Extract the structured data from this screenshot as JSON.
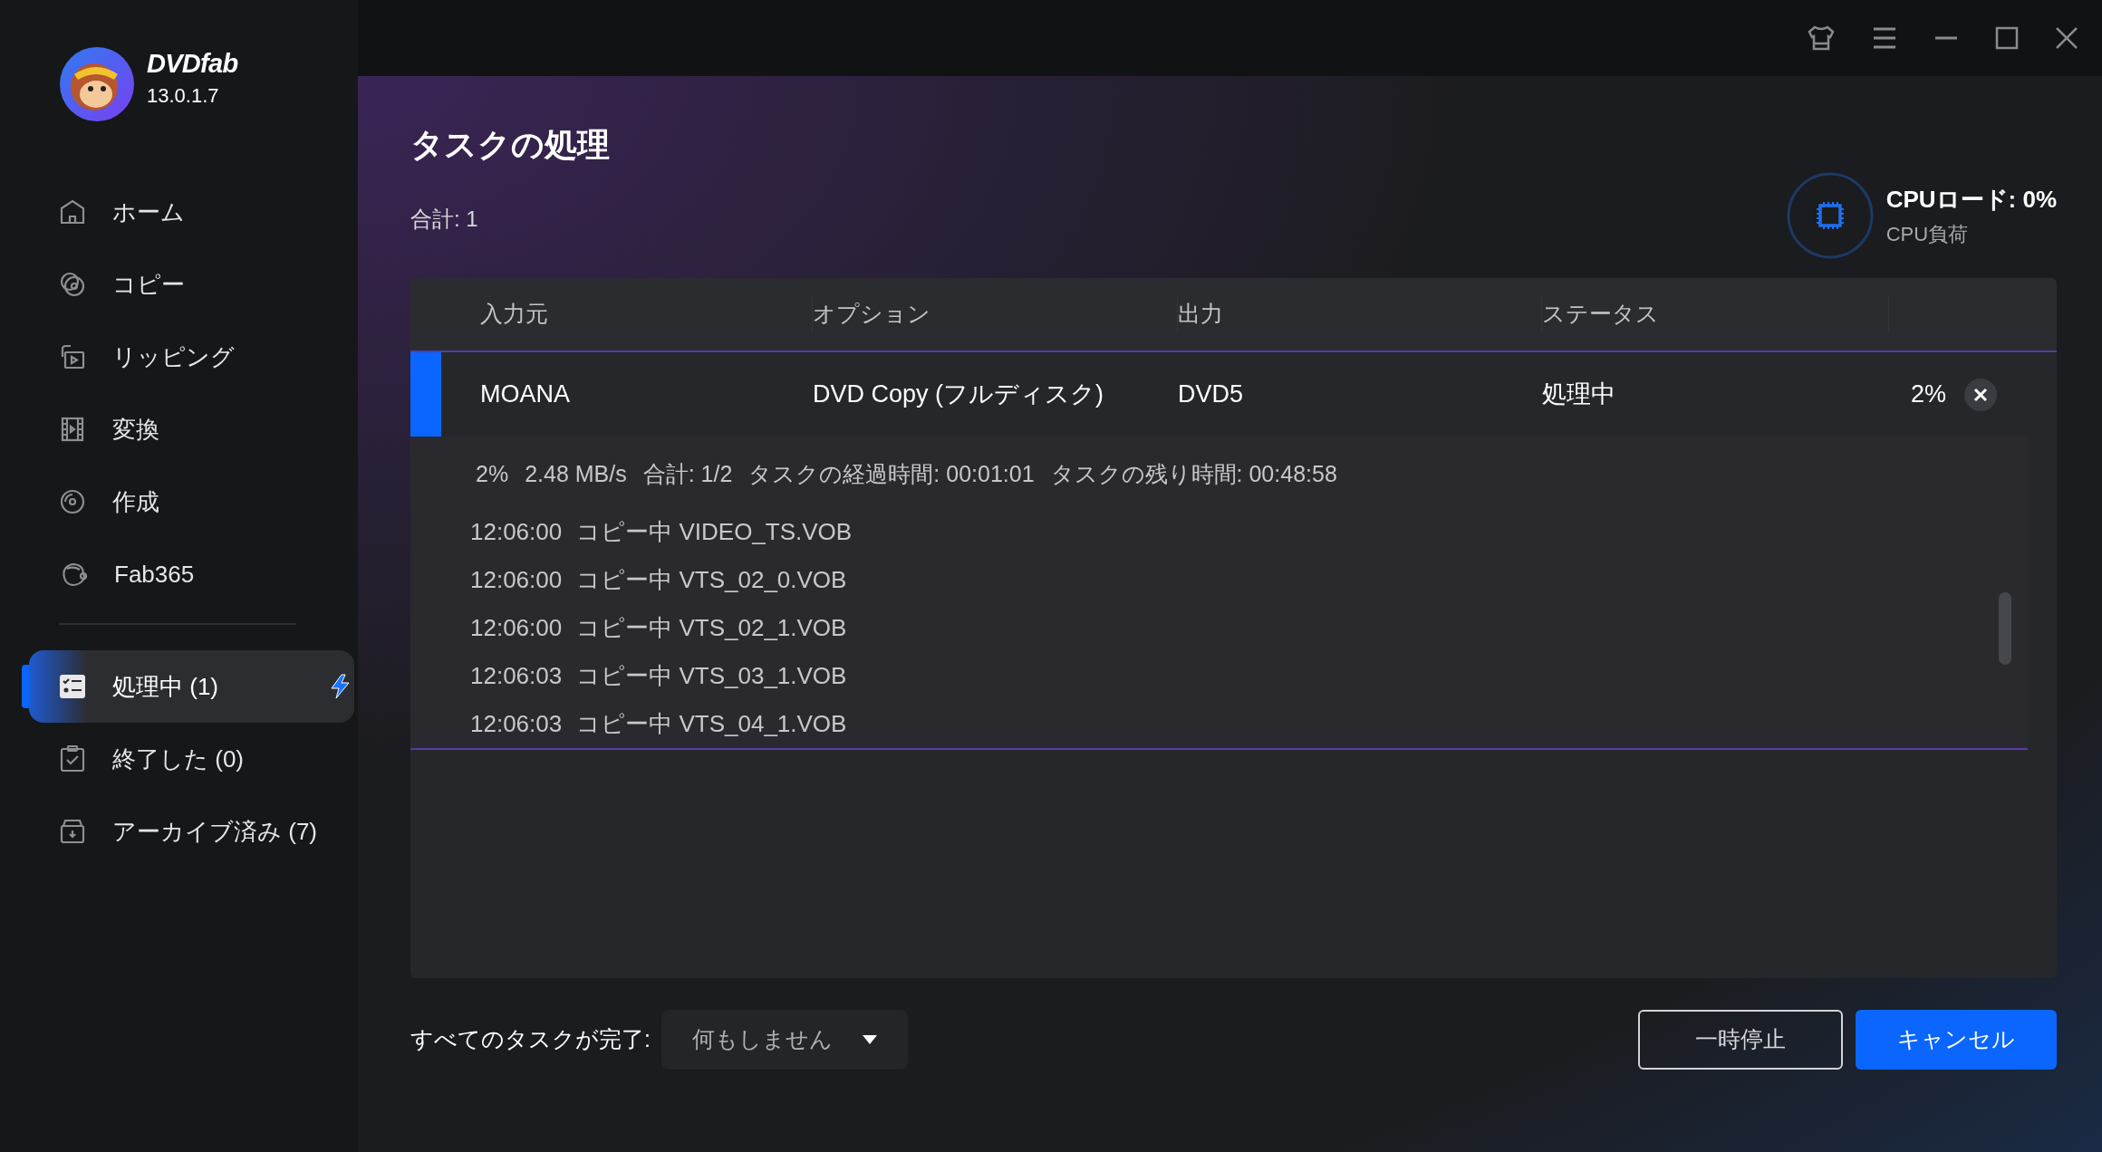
{
  "app": {
    "name": "DVDfab",
    "version": "13.0.1.7"
  },
  "sidebar": {
    "items": [
      {
        "label": "ホーム",
        "selected": false
      },
      {
        "label": "コピー",
        "selected": false
      },
      {
        "label": "リッピング",
        "selected": false
      },
      {
        "label": "変換",
        "selected": false
      },
      {
        "label": "作成",
        "selected": false
      },
      {
        "label": "Fab365",
        "selected": false
      }
    ],
    "queue_items": [
      {
        "label": "処理中 (1)",
        "selected": true
      },
      {
        "label": "終了した (0)",
        "selected": false
      },
      {
        "label": "アーカイブ済み (7)",
        "selected": false
      }
    ]
  },
  "page": {
    "title": "タスクの処理",
    "total": "合計: 1"
  },
  "cpu": {
    "title": "CPUロード: 0%",
    "subtitle": "CPU負荷"
  },
  "table": {
    "columns": [
      "入力元",
      "オプション",
      "出力",
      "ステータス"
    ],
    "rows": [
      {
        "source": "MOANA",
        "option": "DVD Copy (フルディスク)",
        "output": "DVD5",
        "status": "処理中",
        "percent": "2%",
        "expanded": true,
        "stats": [
          "2%",
          "2.48 MB/s",
          "合計: 1/2",
          "タスクの経過時間: 00:01:01",
          "タスクの残り時間: 00:48:58"
        ],
        "log": [
          {
            "time": "12:06:00",
            "message": "コピー中 VIDEO_TS.VOB"
          },
          {
            "time": "12:06:00",
            "message": "コピー中 VTS_02_0.VOB"
          },
          {
            "time": "12:06:00",
            "message": "コピー中 VTS_02_1.VOB"
          },
          {
            "time": "12:06:03",
            "message": "コピー中 VTS_03_1.VOB"
          },
          {
            "time": "12:06:03",
            "message": "コピー中 VTS_04_1.VOB"
          }
        ]
      }
    ]
  },
  "footer": {
    "label": "すべてのタスクが完了:",
    "dropdown": "何もしません",
    "buttons": [
      "一時停止",
      "キャンセル"
    ]
  }
}
